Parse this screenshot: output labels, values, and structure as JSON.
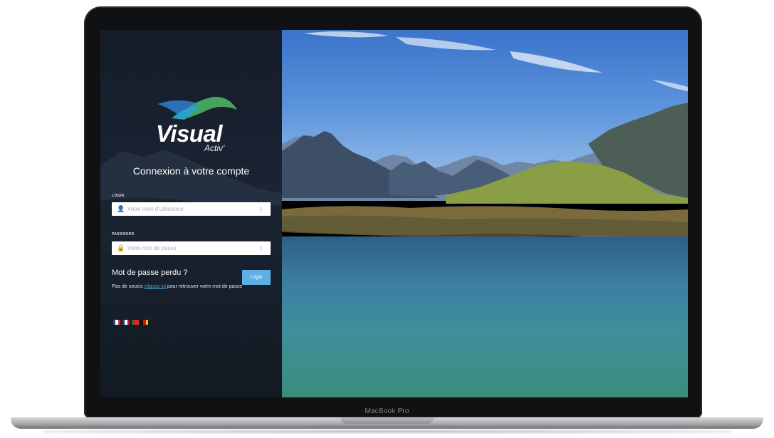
{
  "device": {
    "label": "MacBook Pro"
  },
  "login": {
    "heading": "Connexion à votre compte",
    "logo_text": "Visual",
    "logo_sub": "Activ'",
    "username": {
      "label": "LOGIN",
      "placeholder": "Votre nom d'utilisateur",
      "icon": "user-icon",
      "trailing_icon": "key-icon"
    },
    "password": {
      "label": "PASSWORD",
      "placeholder": "Votre mot de passe",
      "icon": "lock-icon",
      "trailing_icon": "key-icon"
    },
    "forgot": {
      "title": "Mot de passe perdu ?",
      "text_before": "Pas de soucis",
      "link": "cliquez ici",
      "text_after": "pour retrouver votre mot de passe"
    },
    "submit_label": "Login",
    "languages": [
      {
        "name": "fr-flag-icon",
        "colors": [
          "#1e4ba1",
          "#ffffff",
          "#d52b1e"
        ]
      },
      {
        "name": "us-flag-icon",
        "colors": [
          "#2b3f87",
          "#ffffff",
          "#c8102e"
        ]
      },
      {
        "name": "pt-flag-icon",
        "colors": [
          "#1f7a35",
          "#d52b1e",
          "#d52b1e"
        ]
      },
      {
        "name": "de-flag-icon",
        "colors": [
          "#111111",
          "#d9141e",
          "#f3c300"
        ]
      }
    ]
  },
  "colors": {
    "button": "#5bb0e6",
    "link": "#4fa3e0",
    "panel": "#1b2433"
  }
}
